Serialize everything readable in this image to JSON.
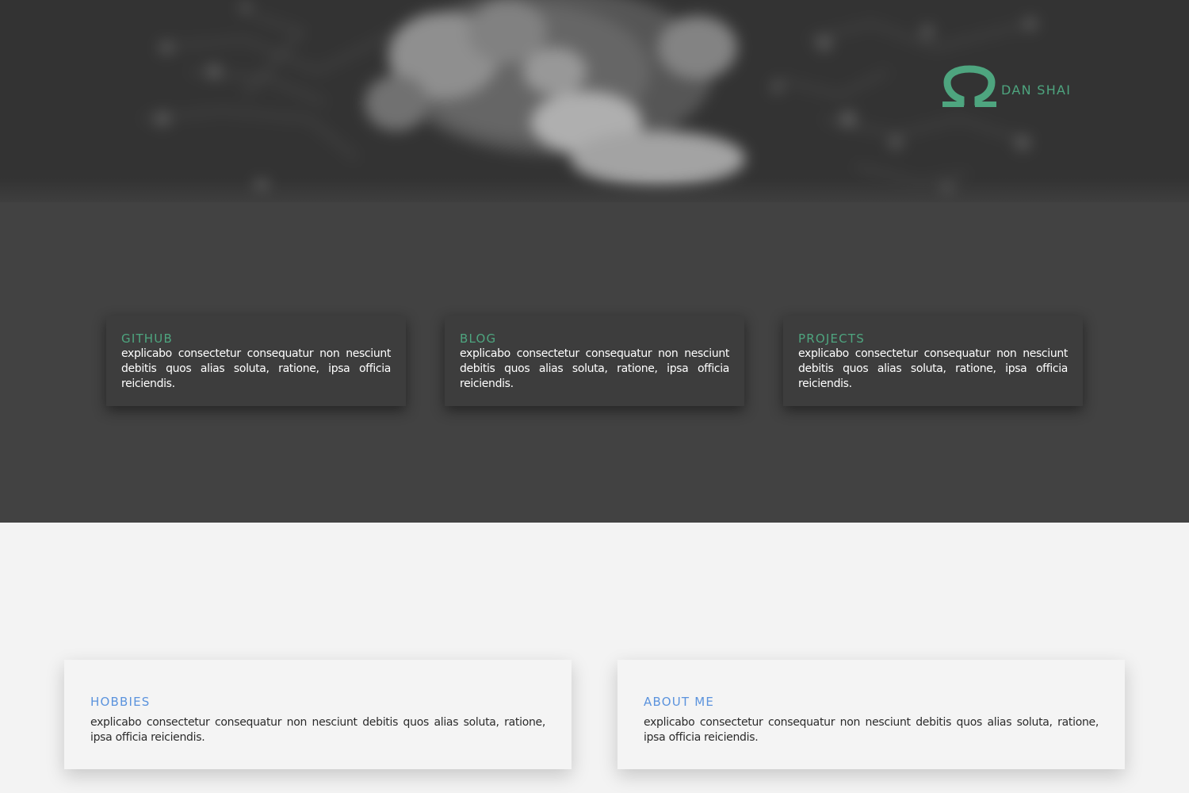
{
  "hero": {
    "brand_name": "DAN SHAI",
    "logo_icon": "omega-icon",
    "accent_color": "#4ea57f"
  },
  "link_cards": [
    {
      "title": "GITHUB",
      "text": "explicabo consectetur consequatur non nesciunt debitis quos alias soluta, ratione, ipsa officia reiciendis."
    },
    {
      "title": "BLOG",
      "text": "explicabo consectetur consequatur non nesciunt debitis quos alias soluta, ratione, ipsa officia reiciendis."
    },
    {
      "title": "PROJECTS",
      "text": "explicabo consectetur consequatur non nesciunt debitis quos alias soluta, ratione, ipsa officia reiciendis."
    }
  ],
  "info_cards": [
    {
      "title": "HOBBIES",
      "text": "explicabo consectetur consequatur non nesciunt debitis quos alias soluta, ratione, ipsa officia reiciendis."
    },
    {
      "title": "ABOUT ME",
      "text": "explicabo consectetur consequatur non nesciunt debitis quos alias soluta, ratione, ipsa officia reiciendis."
    }
  ],
  "colors": {
    "hero_background": "#333333",
    "dark_section": "#424242",
    "link_card_background": "#3d3d3d",
    "light_section": "#f3f3f3",
    "info_title": "#5b93dd"
  }
}
